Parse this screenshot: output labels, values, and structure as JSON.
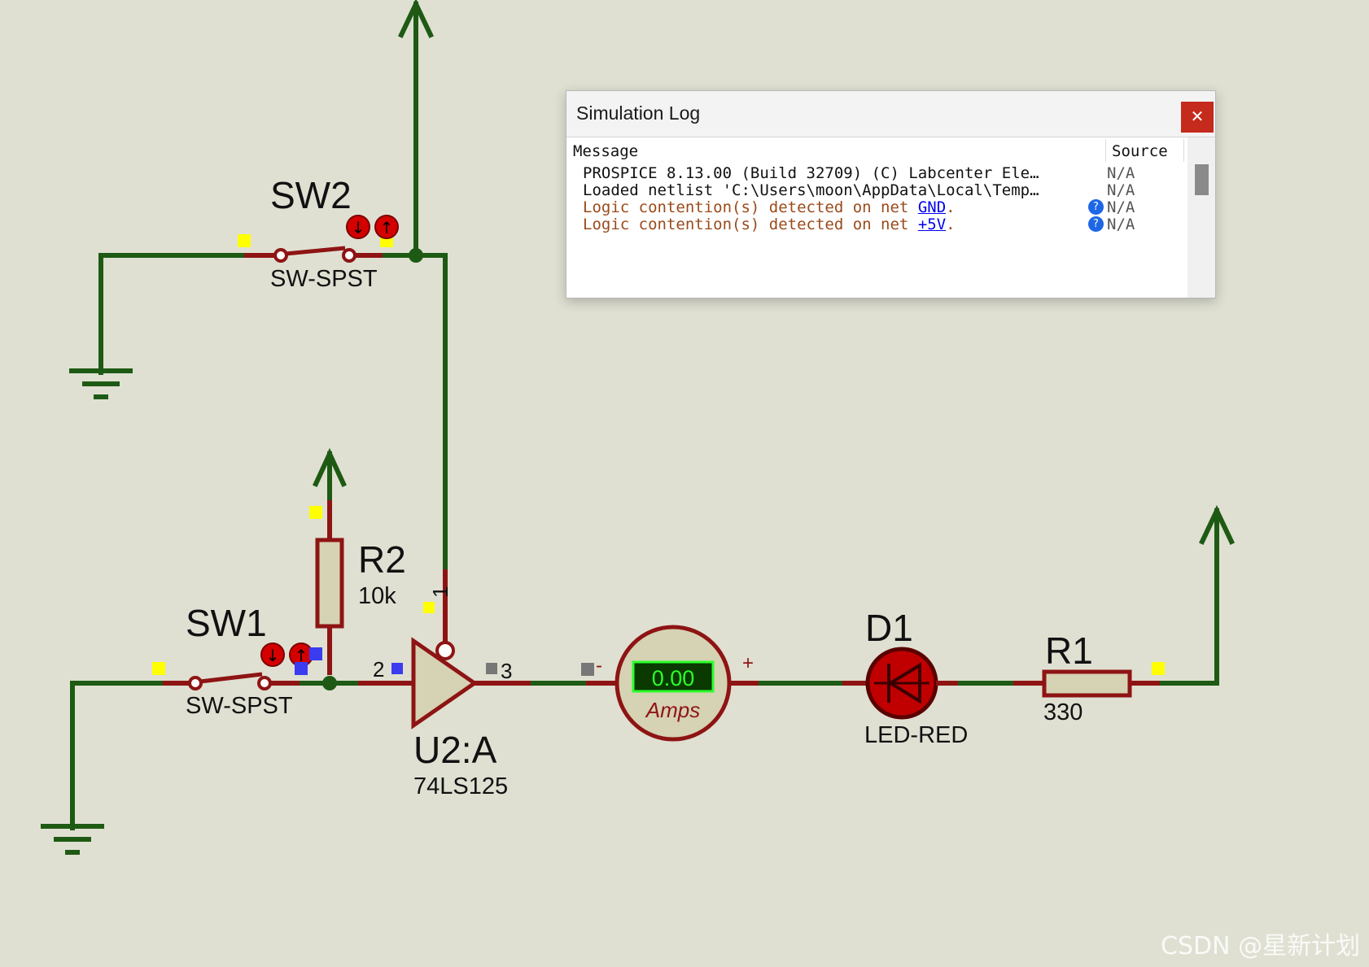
{
  "schematic": {
    "sw2": {
      "ref": "SW2",
      "value": "SW-SPST"
    },
    "sw1": {
      "ref": "SW1",
      "value": "SW-SPST"
    },
    "r2": {
      "ref": "R2",
      "value": "10k"
    },
    "u2": {
      "ref": "U2:A",
      "value": "74LS125",
      "pin_in": "2",
      "pin_out": "3",
      "pin_en": "1"
    },
    "ammeter": {
      "reading": "0.00",
      "unit": "Amps",
      "plus": "+",
      "minus": "-"
    },
    "d1": {
      "ref": "D1",
      "value": "LED-RED"
    },
    "r1": {
      "ref": "R1",
      "value": "330"
    },
    "colors": {
      "wire": "#1e5a14",
      "pin": "#8e1414",
      "body": "#d6d2b4",
      "led": "#c00000",
      "meter_bg": "#0a3a00",
      "meter_fg": "#2bff2b"
    }
  },
  "sim_log": {
    "title": "Simulation Log",
    "close_icon": "close-icon",
    "columns": {
      "message": "Message",
      "source": "Source"
    },
    "rows": [
      {
        "message": "PROSPICE 8.13.00 (Build 32709) (C) Labcenter Ele…",
        "source": "N/A",
        "kind": "info"
      },
      {
        "message": "Loaded netlist 'C:\\Users\\moon\\AppData\\Local\\Temp…",
        "source": "N/A",
        "kind": "info"
      },
      {
        "prefix": "Logic contention(s) detected on net ",
        "net": "GND",
        "suffix": ".",
        "source": "N/A",
        "kind": "warning",
        "help_icon": "?"
      },
      {
        "prefix": "Logic contention(s) detected on net ",
        "net": "+5V",
        "suffix": ".",
        "source": "N/A",
        "kind": "warning",
        "help_icon": "?"
      }
    ]
  },
  "watermark": "CSDN @星新计划"
}
